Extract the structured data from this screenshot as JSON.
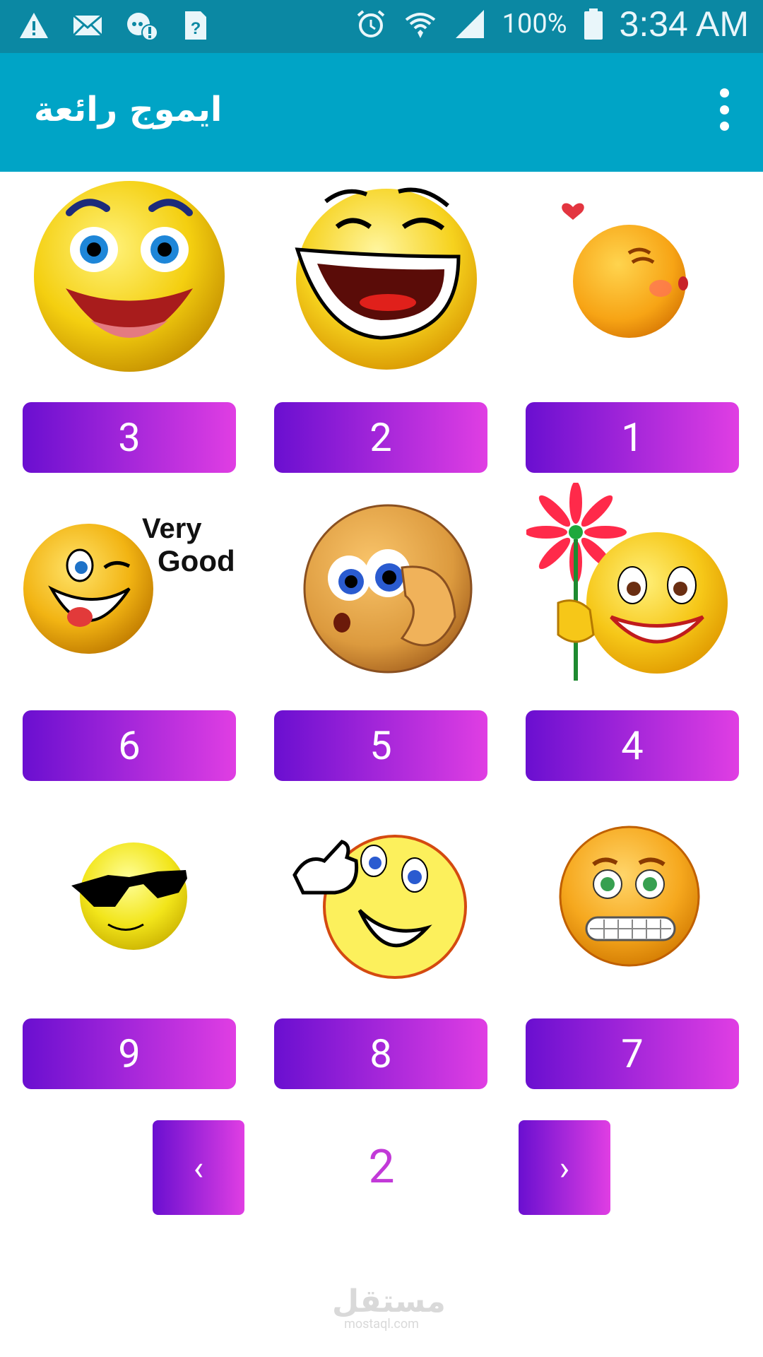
{
  "status_bar": {
    "icons_left": [
      "warning-icon",
      "mail-icon",
      "alert-chat-icon",
      "help-file-icon"
    ],
    "icons_right": [
      "alarm-icon",
      "wifi-icon",
      "signal-icon",
      "battery-icon"
    ],
    "battery": "100%",
    "time": "3:34 AM"
  },
  "appbar": {
    "title": "ايموج رائعة",
    "menu_icon": "more-vert-icon"
  },
  "grid": {
    "buttons": [
      "3",
      "2",
      "1",
      "6",
      "5",
      "4",
      "9",
      "8",
      "7"
    ],
    "emojis": [
      "big-smile",
      "laughing",
      "kissing",
      "very-good-wink",
      "shy-blush",
      "flower-smile",
      "cool-sunglasses",
      "thumbs-up",
      "grimacing"
    ],
    "overlay_text": {
      "very": "Very",
      "good": "Good"
    }
  },
  "pager": {
    "prev": "‹",
    "current": "2",
    "next": "›"
  },
  "watermark": {
    "arabic": "مستقل",
    "latin": "mostaql.com"
  },
  "colors": {
    "status": "#0b88a3",
    "appbar": "#00a4c6",
    "button_start": "#6a0fd0",
    "button_end": "#e03ee3",
    "page_number": "#c239d8"
  }
}
